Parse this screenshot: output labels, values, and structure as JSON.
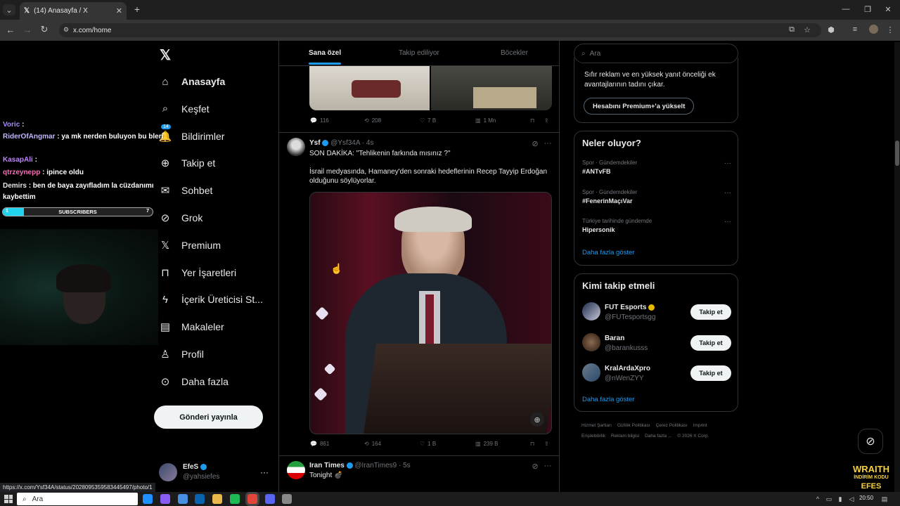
{
  "browser": {
    "tab_title": "(14) Anasayfa / X",
    "url": "x.com/home",
    "status_url": "https://x.com/Ysf34A/status/2028095359583445497/photo/1"
  },
  "sidebar": {
    "items": [
      {
        "label": "Anasayfa",
        "icon": "home-icon"
      },
      {
        "label": "Keşfet",
        "icon": "search-icon"
      },
      {
        "label": "Bildirimler",
        "icon": "bell-icon",
        "badge": "14"
      },
      {
        "label": "Takip et",
        "icon": "add-user-icon"
      },
      {
        "label": "Sohbet",
        "icon": "mail-icon"
      },
      {
        "label": "Grok",
        "icon": "grok-icon"
      },
      {
        "label": "Premium",
        "icon": "x-icon"
      },
      {
        "label": "Yer İşaretleri",
        "icon": "bookmark-icon"
      },
      {
        "label": "İçerik Üreticisi St...",
        "icon": "lightning-icon"
      },
      {
        "label": "Makaleler",
        "icon": "document-icon"
      },
      {
        "label": "Profil",
        "icon": "person-icon"
      },
      {
        "label": "Daha fazla",
        "icon": "more-circle-icon"
      }
    ],
    "post_button": "Gönderi yayınla",
    "account": {
      "name": "EfeS",
      "handle": "@yahsiefes"
    }
  },
  "feed": {
    "tabs": [
      "Sana özel",
      "Takip ediliyor",
      "Böcekler"
    ],
    "prev_post_stats": {
      "replies": "116",
      "reposts": "208",
      "likes": "7 B",
      "views": "1 Mn"
    },
    "post": {
      "name": "Ysf",
      "handle": "@Ysf34A",
      "time": "· 4s",
      "headline": "SON DAKİKA: \"Tehlikenin farkında mısınız ?\"",
      "body": "İsrail medyasında, Hamaney'den sonraki hedeflerinin Recep Tayyip Erdoğan olduğunu söylüyorlar.",
      "stats": {
        "replies": "861",
        "reposts": "164",
        "likes": "1 B",
        "views": "239 B"
      }
    },
    "next_post": {
      "name": "Iran Times",
      "handle": "@IranTimes9",
      "time": "· 5s",
      "body": "Tonight 💣"
    }
  },
  "right": {
    "search_placeholder": "Ara",
    "premium": {
      "text": "Sıfır reklam ve en yüksek yanıt önceliği ek avantajlarının tadını çıkar.",
      "button": "Hesabını Premium+'a yükselt"
    },
    "trends_title": "Neler oluyor?",
    "trends": [
      {
        "category": "Spor · Gündemdekiler",
        "name": "#ANTvFB"
      },
      {
        "category": "Spor · Gündemdekiler",
        "name": "#FenerinMaçıVar"
      },
      {
        "category": "Türkiye tarihinde gündemde",
        "name": "Hipersonik"
      }
    ],
    "show_more": "Daha fazla göster",
    "follow_title": "Kimi takip etmeli",
    "suggestions": [
      {
        "name": "FUT Esports",
        "handle": "@FUTesportsgg",
        "button": "Takip et"
      },
      {
        "name": "Baran",
        "handle": "@barankusss",
        "button": "Takip et"
      },
      {
        "name": "KralArdaXpro",
        "handle": "@nWenZYY",
        "button": "Takip et"
      }
    ],
    "footer": [
      "Hizmet Şartları",
      "Gizlilik Politikası",
      "Çerez Politikası",
      "Imprint",
      "Erişilebilirlik",
      "Reklam bilgisi",
      "Daha fazla ...",
      "© 2026 X Corp."
    ]
  },
  "overlay": {
    "chat": [
      {
        "user": "Voric",
        "msg": ":",
        "color": "#a78bfa"
      },
      {
        "user": "RiderOfAngmar",
        "msg": ": ya mk nerden buluyon bu bleri",
        "color": "#c4b5fd"
      },
      {
        "user": "KasapAli",
        "msg": ":",
        "color": "#c084fc"
      },
      {
        "user": "qtrzeynepp",
        "msg": ": ipince oldu",
        "color": "#f472b6"
      },
      {
        "user": "Demirs",
        "msg": ": ben de baya zayıfladım la cüzdanımı kaybettim",
        "color": "#e5e7eb"
      }
    ],
    "subs_label": "SUBSCRIBERS",
    "subs_current": "1",
    "subs_goal": "7",
    "subs_progress": 0.14,
    "brand_top": "WRAITH",
    "brand_mid": "İNDİRİM KODU",
    "brand_bottom": "EFES"
  },
  "taskbar": {
    "search": "Ara",
    "time": "20:50"
  }
}
